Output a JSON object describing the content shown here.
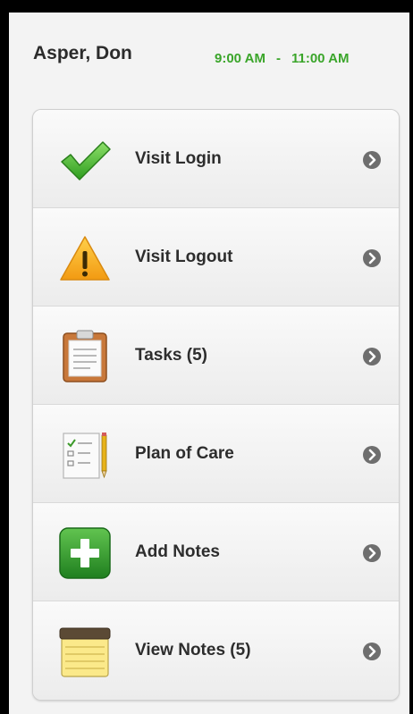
{
  "header": {
    "patient_name": "Asper, Don",
    "start_time": "9:00 AM",
    "separator": "-",
    "end_time": "11:00 AM"
  },
  "menu": {
    "items": [
      {
        "label": "Visit Login",
        "icon": "checkmark-icon"
      },
      {
        "label": "Visit Logout",
        "icon": "warning-icon"
      },
      {
        "label": "Tasks (5)",
        "icon": "clipboard-icon"
      },
      {
        "label": "Plan of Care",
        "icon": "checklist-icon"
      },
      {
        "label": "Add Notes",
        "icon": "add-icon"
      },
      {
        "label": "View Notes (5)",
        "icon": "notepad-icon"
      }
    ]
  },
  "colors": {
    "time_text": "#3aa52a",
    "chevron": "#6e6e6e",
    "add_button": "#2f9a2f",
    "warning": "#f5a623"
  }
}
